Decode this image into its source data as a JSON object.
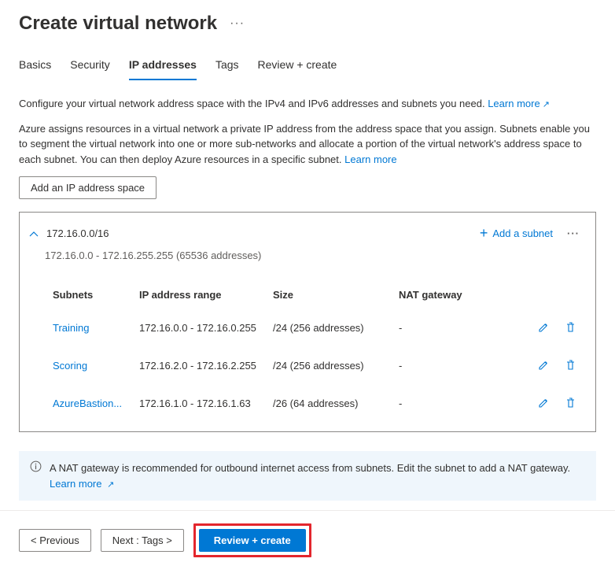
{
  "header": {
    "title": "Create virtual network"
  },
  "tabs": {
    "items": [
      {
        "label": "Basics"
      },
      {
        "label": "Security"
      },
      {
        "label": "IP addresses"
      },
      {
        "label": "Tags"
      },
      {
        "label": "Review + create"
      }
    ]
  },
  "descriptions": {
    "line1": "Configure your virtual network address space with the IPv4 and IPv6 addresses and subnets you need.",
    "line1_link": "Learn more",
    "line2": "Azure assigns resources in a virtual network a private IP address from the address space that you assign. Subnets enable you to segment the virtual network into one or more sub-networks and allocate a portion of the virtual network's address space to each subnet. You can then deploy Azure resources in a specific subnet.",
    "line2_link": "Learn more"
  },
  "buttons": {
    "add_space": "Add an IP address space",
    "add_subnet": "Add a subnet"
  },
  "address_space": {
    "cidr": "172.16.0.0/16",
    "range": "172.16.0.0 - 172.16.255.255 (65536 addresses)"
  },
  "table": {
    "headers": {
      "subnets": "Subnets",
      "range": "IP address range",
      "size": "Size",
      "nat": "NAT gateway"
    },
    "rows": [
      {
        "name": "Training",
        "range": "172.16.0.0 - 172.16.0.255",
        "size": "/24 (256 addresses)",
        "nat": "-"
      },
      {
        "name": "Scoring",
        "range": "172.16.2.0 - 172.16.2.255",
        "size": "/24 (256 addresses)",
        "nat": "-"
      },
      {
        "name": "AzureBastion...",
        "range": "172.16.1.0 - 172.16.1.63",
        "size": "/26 (64 addresses)",
        "nat": "-"
      }
    ]
  },
  "info": {
    "text": "A NAT gateway is recommended for outbound internet access from subnets. Edit the subnet to add a NAT gateway.",
    "link": "Learn more"
  },
  "footer": {
    "previous": "< Previous",
    "next": "Next : Tags >",
    "review": "Review + create"
  }
}
